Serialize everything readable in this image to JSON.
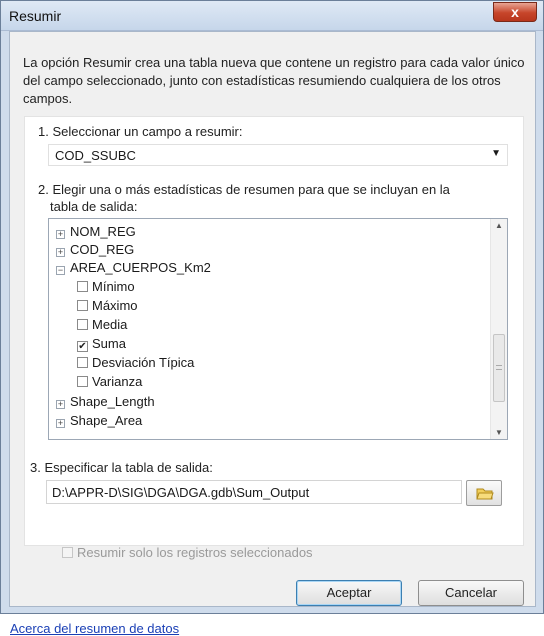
{
  "window": {
    "title": "Resumir",
    "close_label": "x"
  },
  "description": "La opción Resumir crea una tabla nueva que contene un registro para cada valor único del campo seleccionado, junto con estadísticas resumiendo cualquiera de los otros campos.",
  "step1": {
    "label": "1. Seleccionar un campo a resumir:",
    "selected_value": "COD_SSUBC"
  },
  "step2": {
    "label_line1": "2. Elegir una o más estadísticas de resumen para que se incluyan en la",
    "label_line2": "tabla de salida:",
    "tree": {
      "collapsed_top": [
        {
          "expander": "+",
          "label": "NOM_REG"
        },
        {
          "expander": "+",
          "label": "COD_REG"
        }
      ],
      "expanded": {
        "expander": "−",
        "label": "AREA_CUERPOS_Km2"
      },
      "stats": [
        {
          "label": "Mínimo",
          "checked": false,
          "mark": ""
        },
        {
          "label": "Máximo",
          "checked": false,
          "mark": ""
        },
        {
          "label": "Media",
          "checked": false,
          "mark": ""
        },
        {
          "label": "Suma",
          "checked": true,
          "mark": "✔"
        },
        {
          "label": "Desviación Típica",
          "checked": false,
          "mark": ""
        },
        {
          "label": "Varianza",
          "checked": false,
          "mark": ""
        }
      ],
      "collapsed_bottom": [
        {
          "expander": "+",
          "label": "Shape_Length"
        },
        {
          "expander": "+",
          "label": "Shape_Area"
        }
      ]
    }
  },
  "step3": {
    "label": "3. Especificar la tabla de salida:",
    "value": "D:\\APPR-D\\SIG\\DGA\\DGA.gdb\\Sum_Output"
  },
  "summary_checkbox": {
    "label": "Resumir solo los registros seleccionados",
    "checked": false,
    "enabled": false
  },
  "footer": {
    "link": "Acerca del resumen de datos",
    "ok": "Aceptar",
    "cancel": "Cancelar"
  },
  "icons": {
    "close": "close-icon",
    "dropdown": "chevron-down-icon",
    "folder": "folder-icon"
  },
  "colors": {
    "link": "#1a3fb5",
    "close_button": "#c7452a",
    "title_bar": "#cfdcec"
  }
}
